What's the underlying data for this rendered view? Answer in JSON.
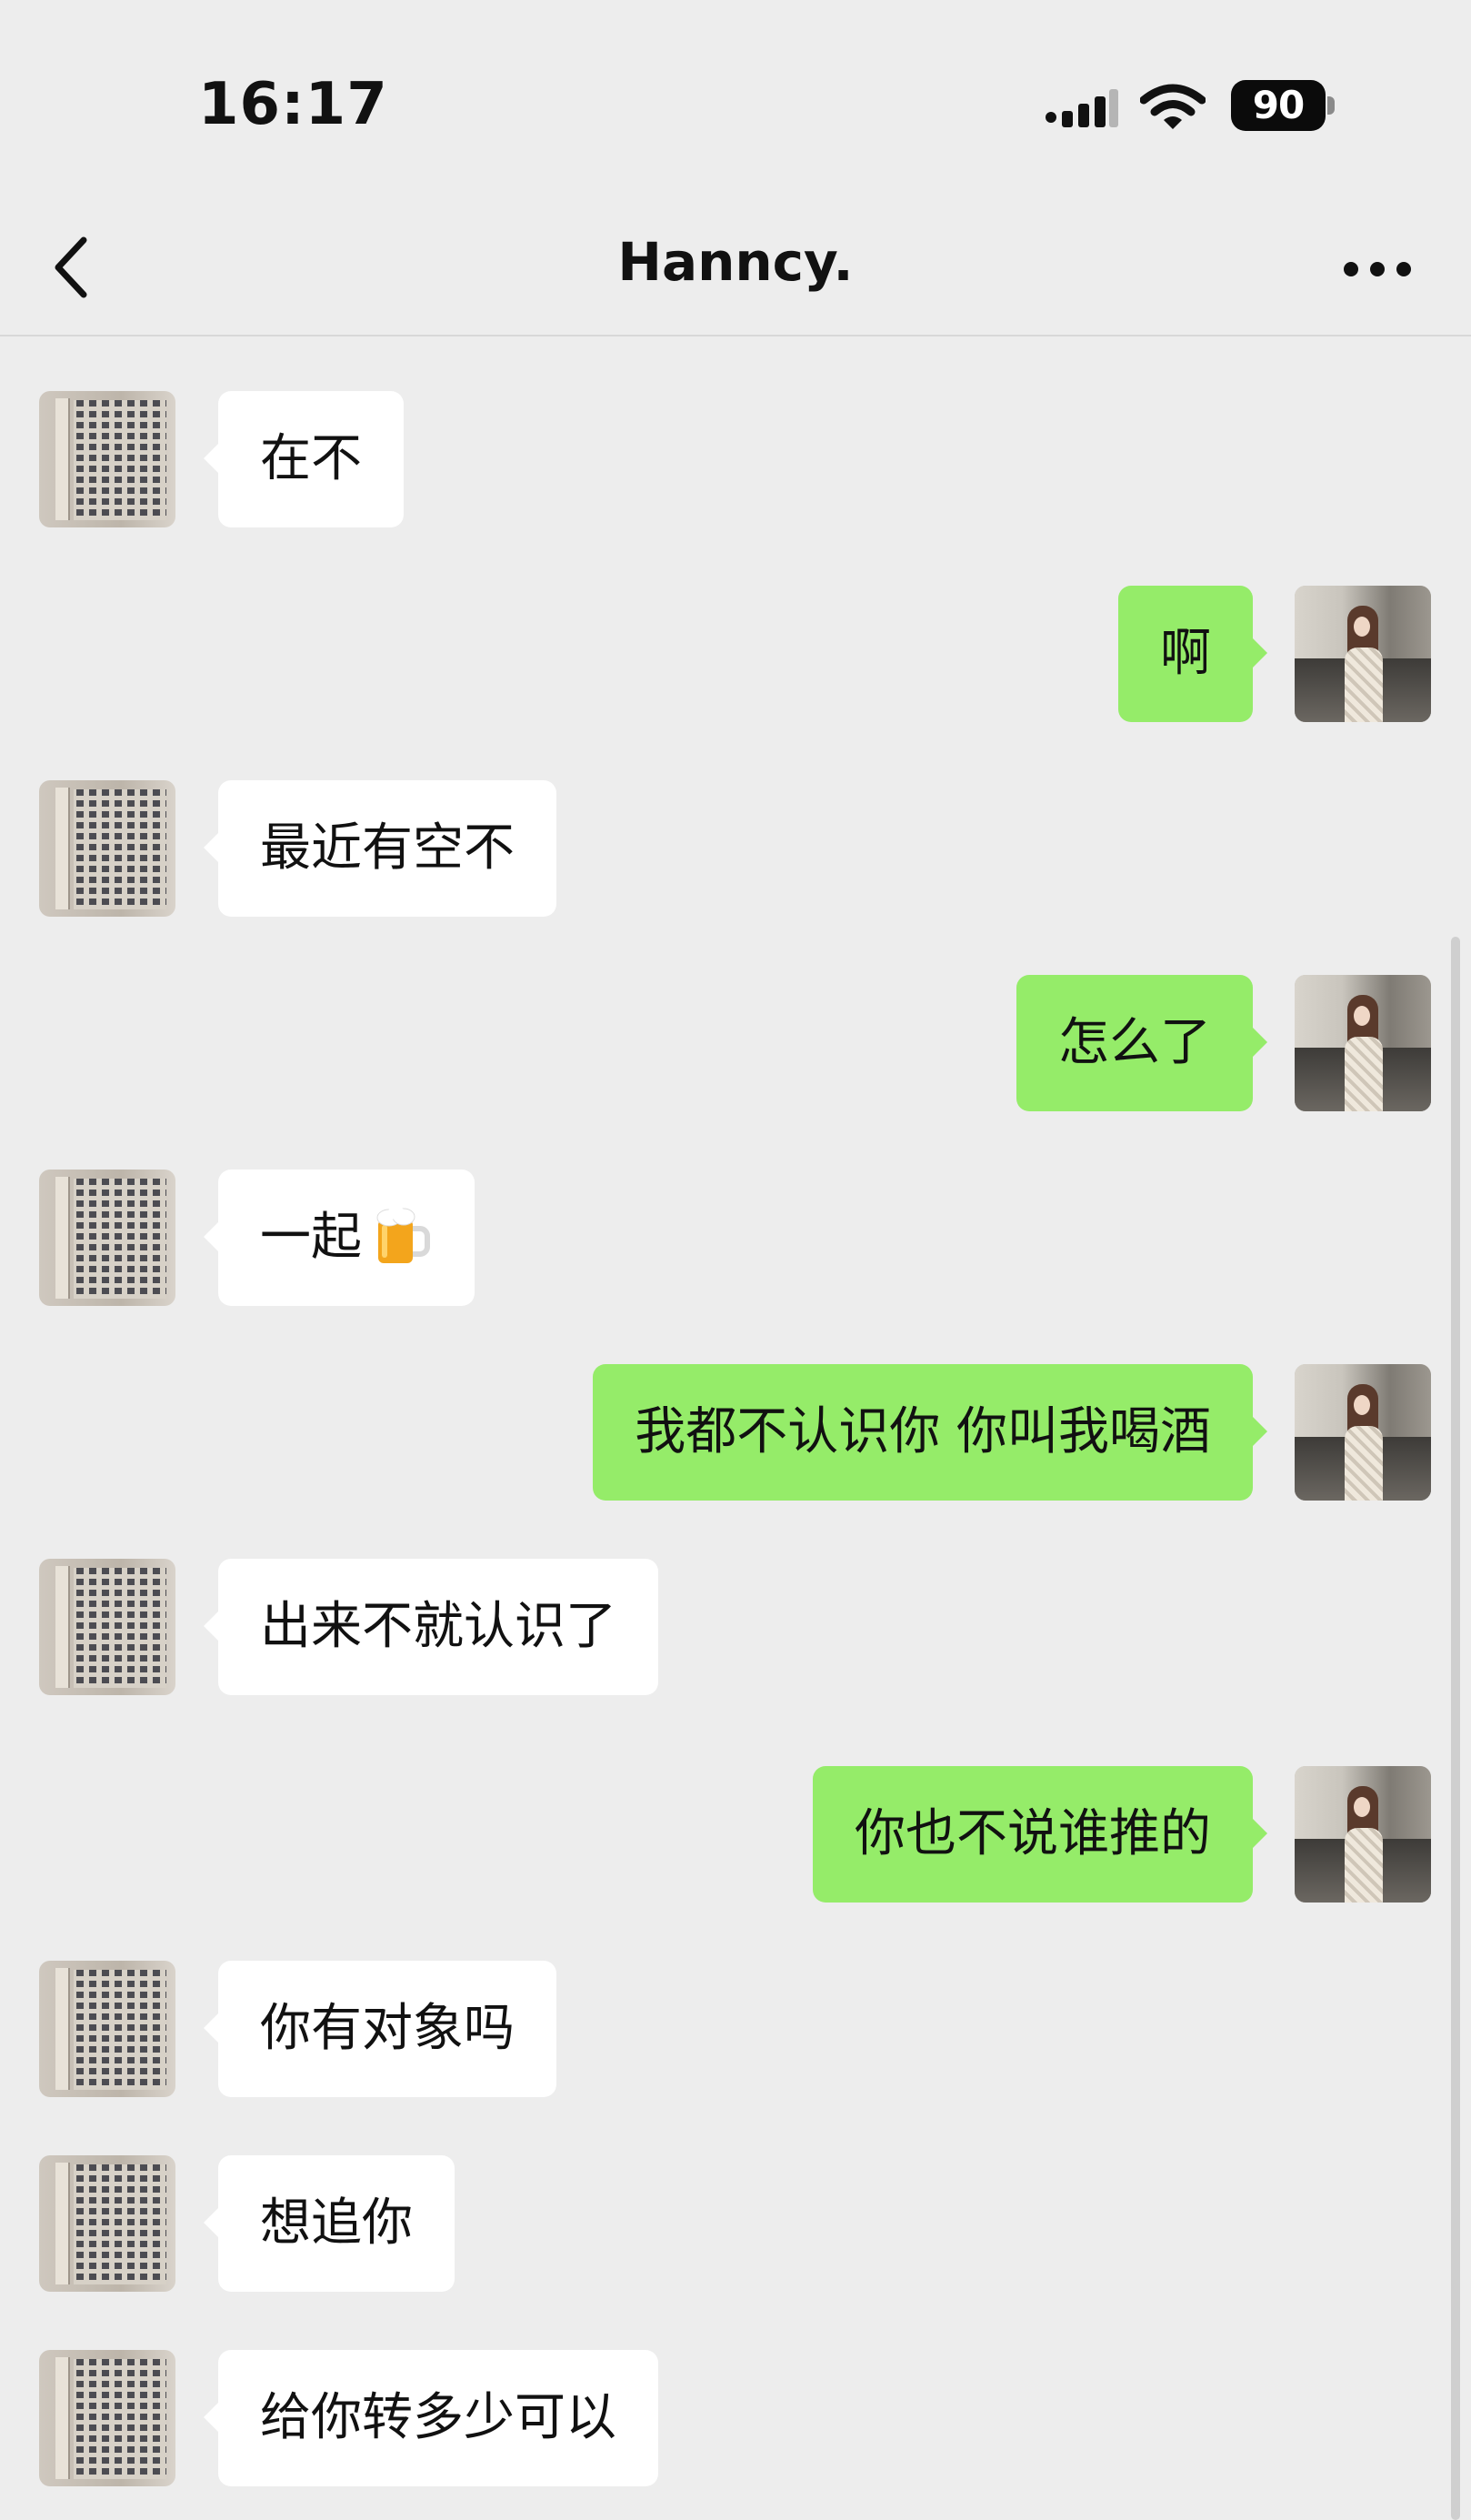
{
  "status_bar": {
    "time": "16:17",
    "battery": "90",
    "icons": [
      "signal-icon",
      "wifi-icon",
      "battery-icon"
    ]
  },
  "nav": {
    "title": "Hanncy.",
    "back_icon": "chevron-left-icon",
    "more_icon": "more-dots-icon"
  },
  "colors": {
    "background": "#ededed",
    "incoming_bubble": "#ffffff",
    "outgoing_bubble": "#95ec69"
  },
  "messages": [
    {
      "side": "left",
      "text": "在不"
    },
    {
      "side": "right",
      "text": "啊"
    },
    {
      "side": "left",
      "text": "最近有空不"
    },
    {
      "side": "right",
      "text": "怎么了"
    },
    {
      "side": "left",
      "text": "一起",
      "emoji": "beer-mug-icon"
    },
    {
      "side": "right",
      "text": "我都不认识你 你叫我喝酒"
    },
    {
      "side": "left",
      "text": "出来不就认识了"
    },
    {
      "side": "right",
      "text": "你也不说谁推的"
    },
    {
      "side": "left",
      "text": "你有对象吗"
    },
    {
      "side": "left",
      "text": "想追你"
    },
    {
      "side": "left",
      "text": "给你转多少可以"
    }
  ]
}
